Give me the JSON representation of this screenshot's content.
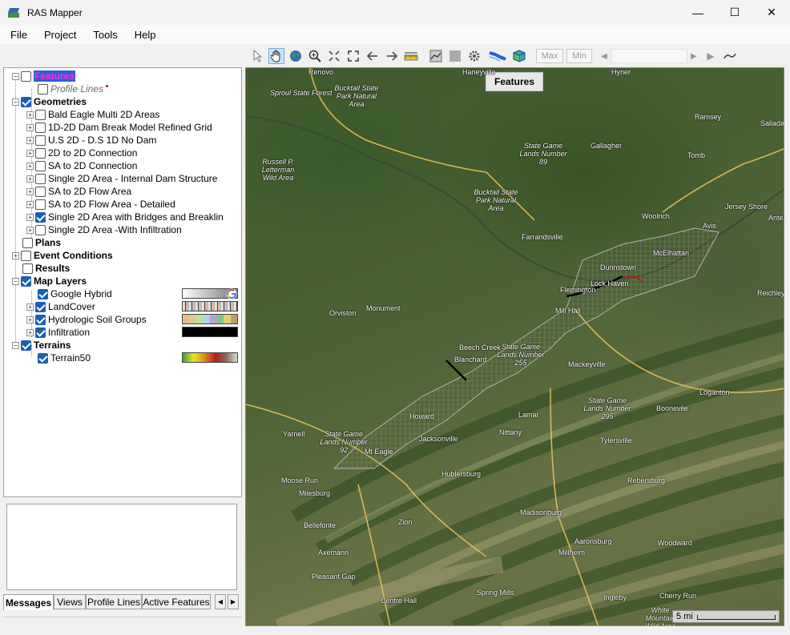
{
  "window": {
    "title": "RAS Mapper",
    "minimize": "—",
    "maximize": "☐",
    "close": "✕"
  },
  "menu": [
    "File",
    "Project",
    "Tools",
    "Help"
  ],
  "toolbar": {
    "max_label": "Max",
    "min_label": "Min",
    "icons": [
      "pointer-icon",
      "pan-hand-icon",
      "globe-icon",
      "zoom-in-icon",
      "zoom-extent-icon",
      "full-extent-icon",
      "back-arrow-icon",
      "forward-arrow-icon",
      "measure-ruler-icon",
      "profile-chart-icon",
      "hatch-layer-icon",
      "settings-gear-icon",
      "stream-line-icon",
      "3d-cube-icon"
    ]
  },
  "tree": {
    "features": {
      "label": "Features",
      "children": [
        {
          "label": "Profile Lines"
        }
      ]
    },
    "geometries": {
      "label": "Geometries",
      "items": [
        {
          "label": "Bald Eagle Multi 2D Areas",
          "checked": false
        },
        {
          "label": "1D-2D Dam Break Model Refined Grid",
          "checked": false
        },
        {
          "label": "U.S 2D - D.S 1D No Dam",
          "checked": false
        },
        {
          "label": "2D to 2D Connection",
          "checked": false
        },
        {
          "label": "SA to 2D Connection",
          "checked": false
        },
        {
          "label": "Single 2D Area - Internal Dam Structure",
          "checked": false
        },
        {
          "label": "SA to 2D Flow Area",
          "checked": false
        },
        {
          "label": "SA to 2D Flow Area - Detailed",
          "checked": false
        },
        {
          "label": "Single 2D Area with Bridges and Breaklin",
          "checked": true
        },
        {
          "label": "Single 2D Area -With Infiltration",
          "checked": false
        }
      ]
    },
    "plans": {
      "label": "Plans"
    },
    "event_conditions": {
      "label": "Event Conditions"
    },
    "results": {
      "label": "Results"
    },
    "map_layers": {
      "label": "Map Layers",
      "items": [
        {
          "label": "Google Hybrid"
        },
        {
          "label": "LandCover"
        },
        {
          "label": "Hydrologic Soil Groups"
        },
        {
          "label": "Infiltration"
        }
      ]
    },
    "terrains": {
      "label": "Terrains",
      "items": [
        {
          "label": "Terrain50"
        }
      ]
    }
  },
  "tabs": [
    "Messages",
    "Views",
    "Profile Lines",
    "Active Features"
  ],
  "map": {
    "overlay_label": "Features",
    "scale_label": "5 mi",
    "place_labels": [
      "Renovo",
      "Sproul State Forest",
      "Bucktail State Park Natural Area",
      "Haneyville",
      "Hyner",
      "Ramsey",
      "Sallada",
      "State Game Lands Number 89",
      "Gallagher",
      "Tomb",
      "Russell P. Letterman Wild Area",
      "Bucktail State Park Natural Area",
      "Jersey Shore",
      "Antes",
      "Woolrich",
      "Farrandsville",
      "Avis",
      "Dunnstown",
      "McElhattan",
      "Flemington",
      "Lock Haven",
      "Mill Hall",
      "Reichley",
      "Orviston",
      "Monument",
      "Beech Creek",
      "Blanchard",
      "State Game Lands Number 255",
      "Mackeyville",
      "State Game Lands Number 295",
      "Loganton",
      "Howard",
      "Lamar",
      "Boonevile",
      "Tylersville",
      "Yarnell",
      "State Game Lands Number 92",
      "Jacksonville",
      "Nittany",
      "Mt Eagle",
      "Moose Run",
      "Milesburg",
      "Hublersburg",
      "Rebersburg",
      "Bellefonte",
      "Zion",
      "Madisonburg",
      "Aaronsburg",
      "Millheim",
      "Woodward",
      "Axemann",
      "Pleasant Gap",
      "Spring Mills",
      "Centre Hall",
      "Ingleby",
      "Cherry Run",
      "White Mountain Wild Area"
    ]
  }
}
